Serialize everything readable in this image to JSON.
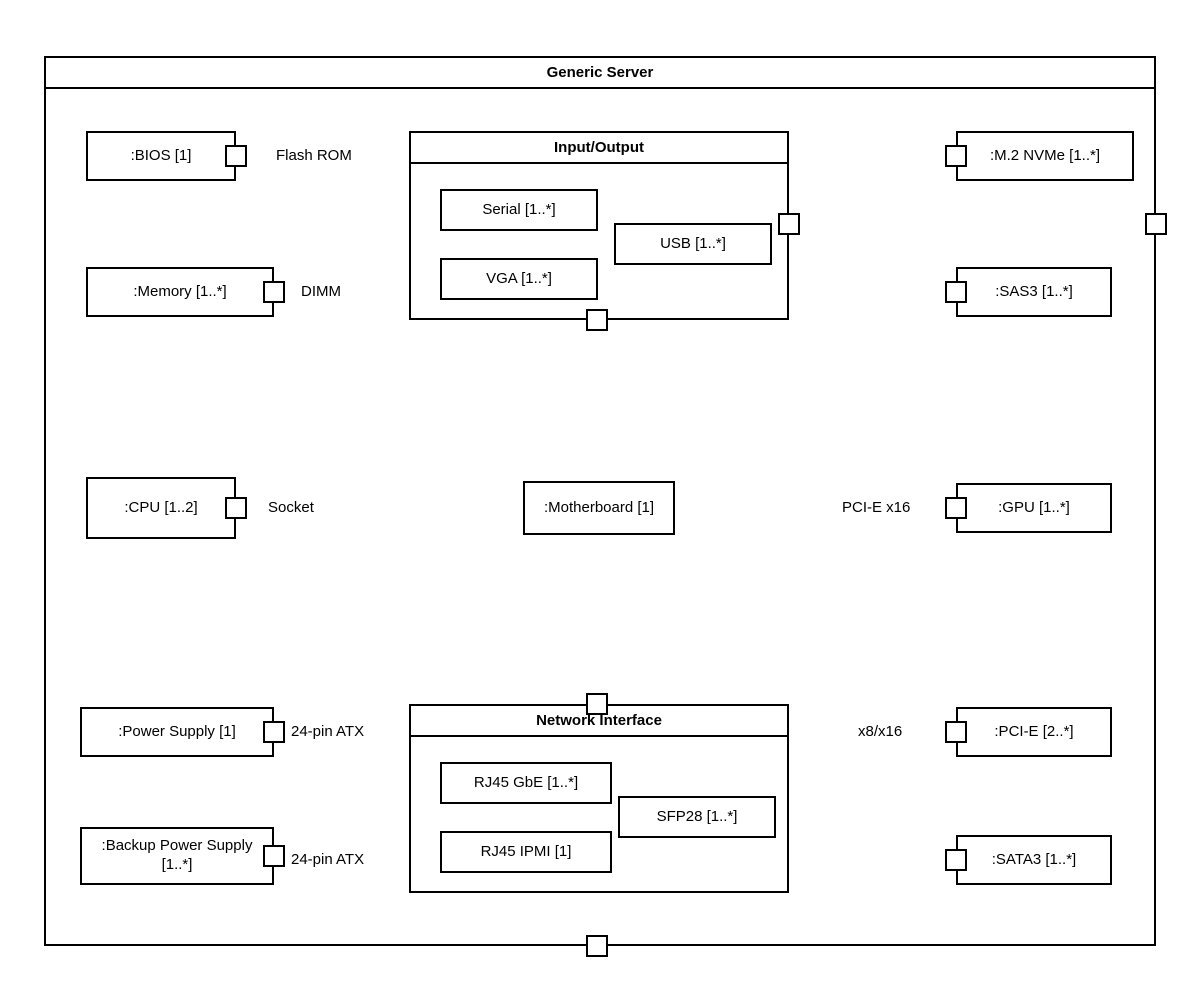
{
  "frame": {
    "title": "Generic Server"
  },
  "motherboard": {
    "label": ":Motherboard [1]"
  },
  "io": {
    "title": "Input/Output",
    "serial": "Serial [1..*]",
    "usb": "USB [1..*]",
    "vga": "VGA [1..*]"
  },
  "net": {
    "title": "Network Interface",
    "rj45gbe": "RJ45 GbE [1..*]",
    "rj45ipmi": "RJ45 IPMI [1]",
    "sfp28": "SFP28 [1..*]"
  },
  "left": {
    "bios": ":BIOS [1]",
    "memory": ":Memory [1..*]",
    "cpu": ":CPU [1..2]",
    "psu": ":Power Supply [1]",
    "bpsu": ":Backup Power Supply [1..*]"
  },
  "right": {
    "m2": ":M.2 NVMe [1..*]",
    "sas3": ":SAS3 [1..*]",
    "gpu": ":GPU [1..*]",
    "pcie": ":PCI-E [2..*]",
    "sata3": ":SATA3 [1..*]"
  },
  "edges": {
    "flashrom": "Flash ROM",
    "dimm": "DIMM",
    "socket": "Socket",
    "atx1": "24-pin ATX",
    "atx2": "24-pin ATX",
    "pciex16": "PCI-E x16",
    "x8x16": "x8/x16"
  }
}
